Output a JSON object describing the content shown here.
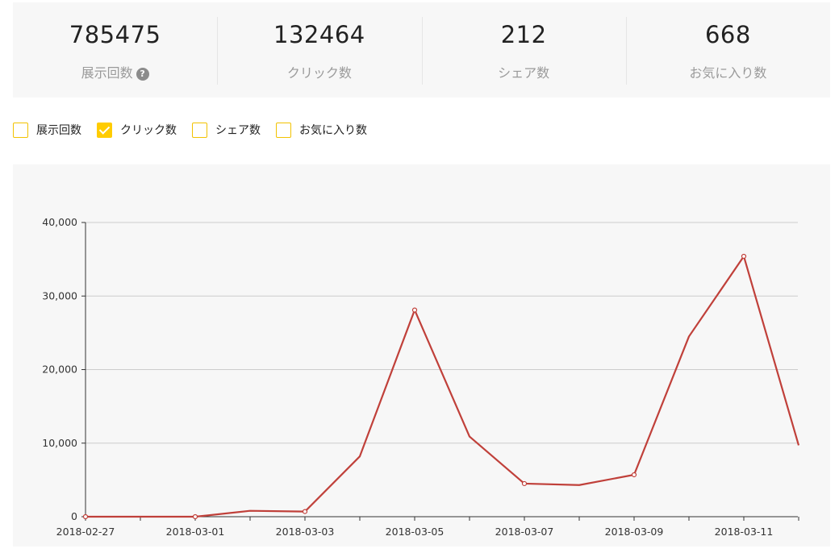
{
  "stats": [
    {
      "value": "785475",
      "label": "展示回数",
      "help_icon": "help-circle-icon"
    },
    {
      "value": "132464",
      "label": "クリック数"
    },
    {
      "value": "212",
      "label": "シェア数"
    },
    {
      "value": "668",
      "label": "お気に入り数"
    }
  ],
  "filters": [
    {
      "label": "展示回数",
      "checked": false
    },
    {
      "label": "クリック数",
      "checked": true
    },
    {
      "label": "シェア数",
      "checked": false
    },
    {
      "label": "お気に入り数",
      "checked": false
    }
  ],
  "colors": {
    "accent": "#ffcc00",
    "line": "#c0403a",
    "panel_bg": "#f7f7f7",
    "grid": "#cccccc"
  },
  "chart_data": {
    "type": "line",
    "title": "",
    "xlabel": "",
    "ylabel": "",
    "x": [
      "2018-02-27",
      "2018-02-28",
      "2018-03-01",
      "2018-03-02",
      "2018-03-03",
      "2018-03-04",
      "2018-03-05",
      "2018-03-06",
      "2018-03-07",
      "2018-03-08",
      "2018-03-09",
      "2018-03-10",
      "2018-03-11",
      "2018-03-12"
    ],
    "x_tick_labels": [
      "2018-02-27",
      "2018-03-01",
      "2018-03-03",
      "2018-03-05",
      "2018-03-07",
      "2018-03-09",
      "2018-03-11"
    ],
    "series": [
      {
        "values": [
          0,
          0,
          0,
          800,
          700,
          8200,
          28100,
          10900,
          4500,
          4300,
          5700,
          24500,
          35400,
          9700
        ],
        "marked": [
          true,
          false,
          true,
          false,
          true,
          false,
          true,
          false,
          true,
          false,
          true,
          false,
          true,
          false
        ]
      }
    ],
    "ylim": [
      0,
      40000
    ],
    "y_ticks": [
      0,
      10000,
      20000,
      30000,
      40000
    ],
    "y_tick_labels": [
      "0",
      "10,000",
      "20,000",
      "30,000",
      "40,000"
    ],
    "grid": true,
    "legend": "none"
  }
}
